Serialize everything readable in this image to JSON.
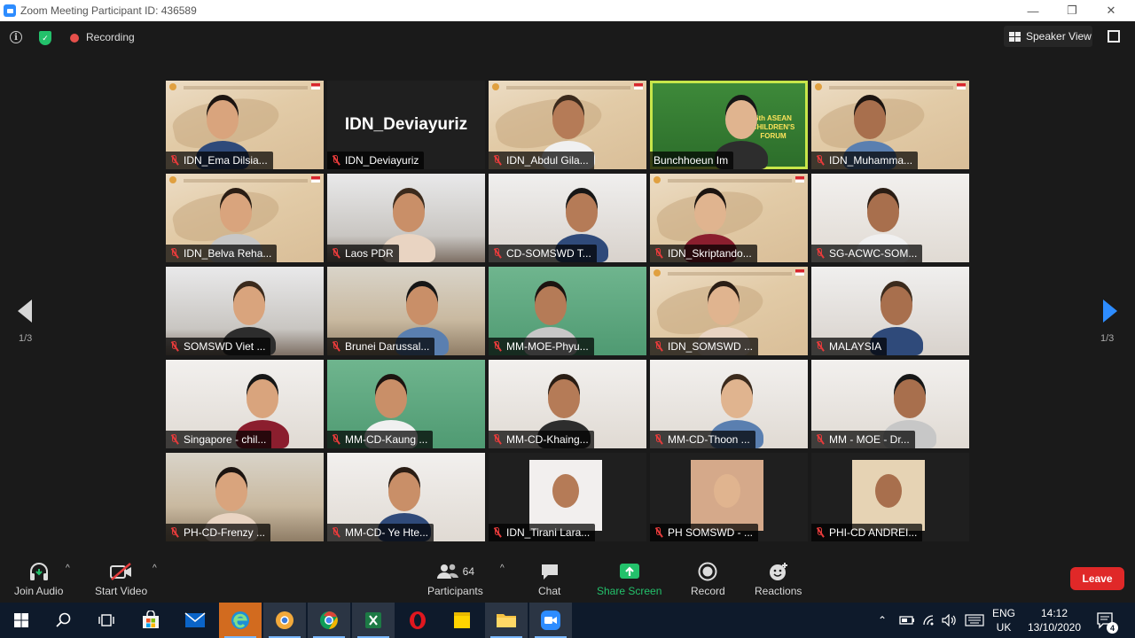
{
  "window": {
    "title": "Zoom Meeting Participant ID: 436589",
    "minimize": "—",
    "restore": "❐",
    "close": "✕"
  },
  "topbar": {
    "info_glyph": "i",
    "recording_label": "Recording",
    "view_button": "Speaker View"
  },
  "pagination": {
    "left": "1/3",
    "right": "1/3"
  },
  "participants": [
    {
      "name": "IDN_Ema Dilsia...",
      "bg": "bg-map"
    },
    {
      "name": "IDN_Deviayuriz",
      "bg": "bg-dark",
      "video_off": true
    },
    {
      "name": "IDN_Abdul Gila...",
      "bg": "bg-map"
    },
    {
      "name": "Bunchhoeun Im",
      "bg": "bg-forum",
      "active": true,
      "muted": false
    },
    {
      "name": "IDN_Muhamma...",
      "bg": "bg-map"
    },
    {
      "name": "IDN_Belva Reha...",
      "bg": "bg-map"
    },
    {
      "name": "Laos PDR",
      "bg": "bg-office"
    },
    {
      "name": "CD-SOMSWD T...",
      "bg": "bg-asean"
    },
    {
      "name": "IDN_Skriptando...",
      "bg": "bg-map"
    },
    {
      "name": "SG-ACWC-SOM...",
      "bg": "bg-white"
    },
    {
      "name": "SOMSWD Viet ...",
      "bg": "bg-office"
    },
    {
      "name": "Brunei Darussal...",
      "bg": "bg-room"
    },
    {
      "name": "MM-MOE-Phyu...",
      "bg": "bg-green"
    },
    {
      "name": "IDN_SOMSWD ...",
      "bg": "bg-map"
    },
    {
      "name": "MALAYSIA",
      "bg": "bg-asean"
    },
    {
      "name": "Singapore - chil...",
      "bg": "bg-white"
    },
    {
      "name": "MM-CD-Kaung ...",
      "bg": "bg-green"
    },
    {
      "name": "MM-CD-Khaing...",
      "bg": "bg-white"
    },
    {
      "name": "MM-CD-Thoon ...",
      "bg": "bg-white"
    },
    {
      "name": "MM - MOE - Dr...",
      "bg": "bg-white"
    },
    {
      "name": "PH-CD-Frenzy ...",
      "bg": "bg-room"
    },
    {
      "name": "MM-CD- Ye Hte...",
      "bg": "bg-white"
    },
    {
      "name": "IDN_Tirani Lara...",
      "bg": "bg-dark"
    },
    {
      "name": "PH SOMSWD - ...",
      "bg": "bg-dark"
    },
    {
      "name": "PHI-CD ANDREI...",
      "bg": "bg-dark"
    }
  ],
  "forum_banner": "6th ASEAN CHILDREN'S FORUM",
  "toolbar": {
    "join_audio": "Join Audio",
    "start_video": "Start Video",
    "participants_label": "Participants",
    "participants_count": "64",
    "chat": "Chat",
    "share_screen": "Share Screen",
    "record": "Record",
    "reactions": "Reactions",
    "leave": "Leave"
  },
  "colors": {
    "share_green": "#23c16b",
    "leave_red": "#e02828",
    "accent_blue": "#2d8cff",
    "active_speaker": "#c8e64a"
  },
  "taskbar": {
    "apps": [
      "windows-start",
      "search",
      "task-view",
      "store",
      "mail",
      "edge",
      "chrome-canary",
      "chrome",
      "excel",
      "opera",
      "sticky-notes",
      "file-explorer",
      "zoom"
    ],
    "lang_top": "ENG",
    "lang_bottom": "UK",
    "time": "14:12",
    "date": "13/10/2020",
    "notifications": "4"
  }
}
